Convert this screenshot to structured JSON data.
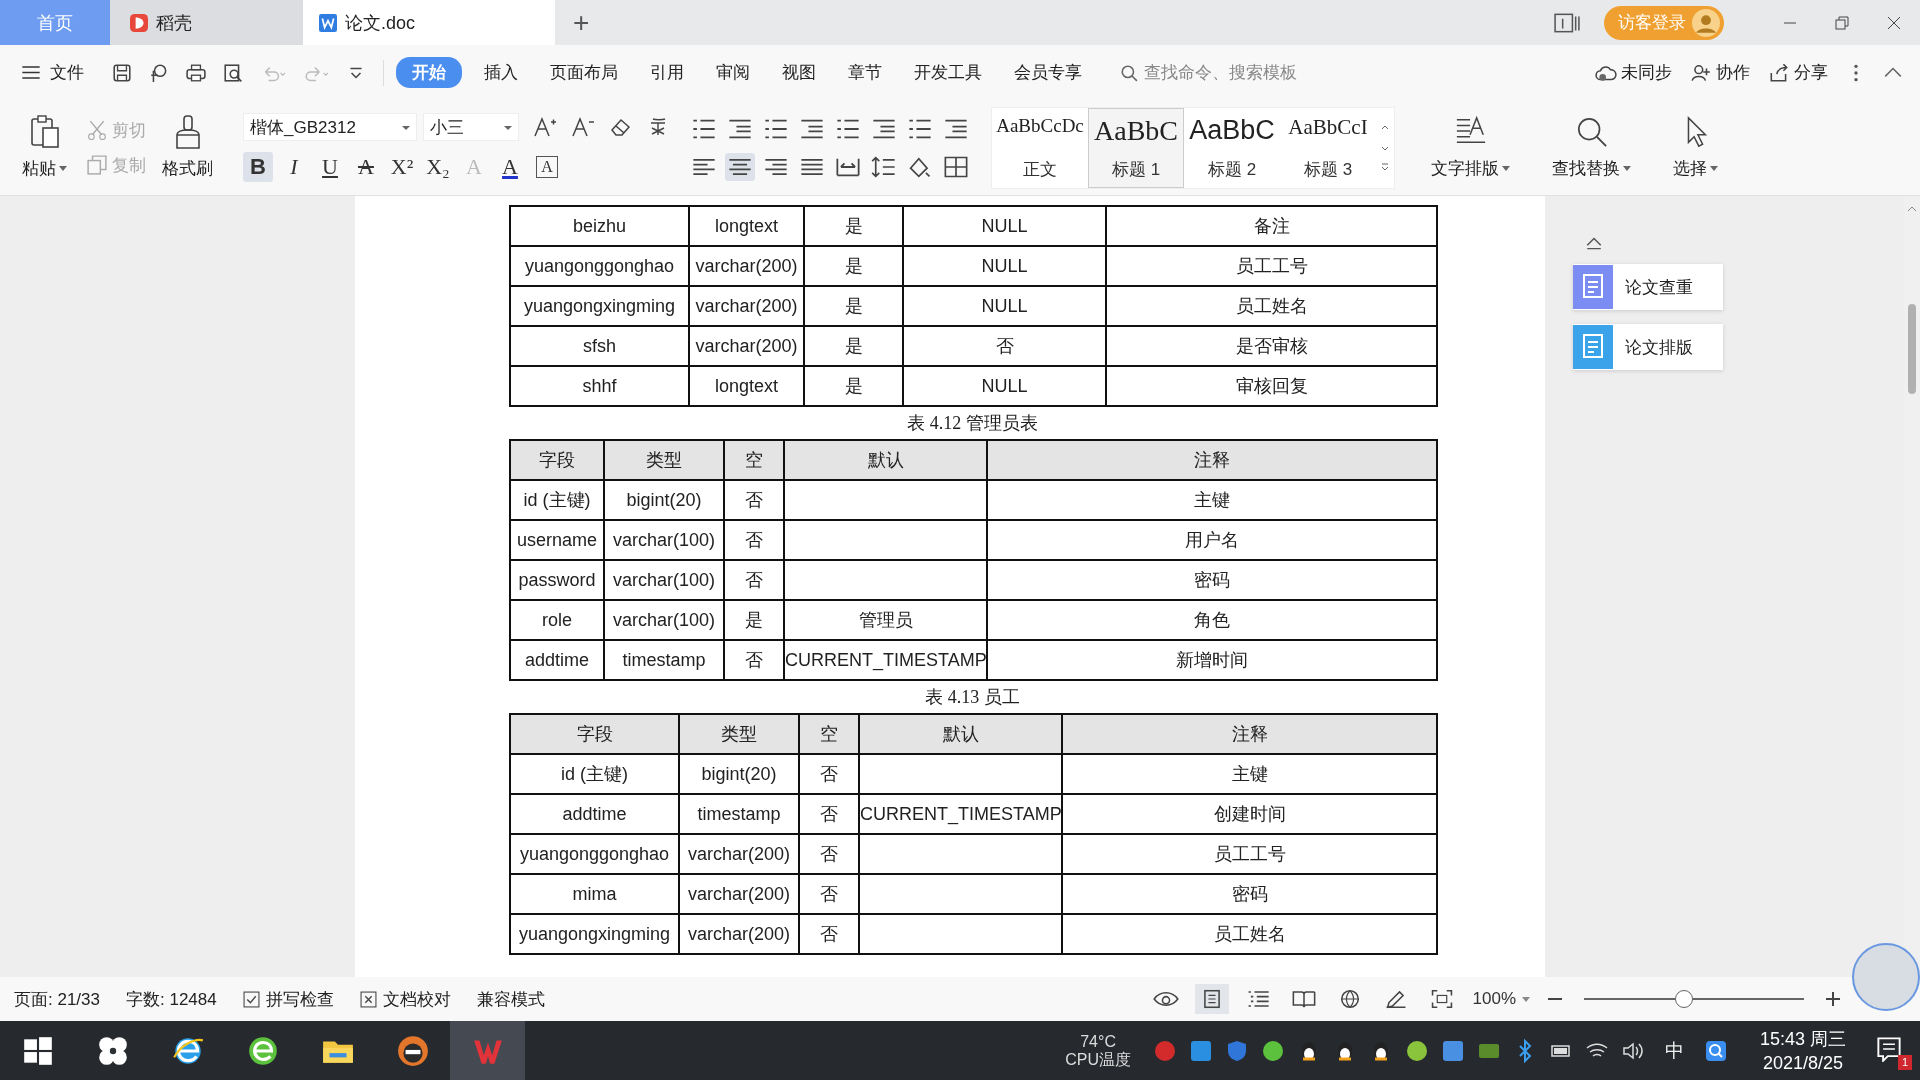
{
  "tabs": [
    {
      "label": "首页",
      "kind": "home",
      "selected": false
    },
    {
      "label": "稻壳",
      "kind": "docer",
      "selected": false
    },
    {
      "label": "论文.doc",
      "kind": "doc",
      "selected": true
    }
  ],
  "new_tab": "+",
  "login": "访客登录",
  "menu": {
    "file": "文件",
    "items": [
      {
        "label": "开始",
        "selected": true
      },
      {
        "label": "插入",
        "selected": false
      },
      {
        "label": "页面布局",
        "selected": false
      },
      {
        "label": "引用",
        "selected": false
      },
      {
        "label": "审阅",
        "selected": false
      },
      {
        "label": "视图",
        "selected": false
      },
      {
        "label": "章节",
        "selected": false
      },
      {
        "label": "开发工具",
        "selected": false
      },
      {
        "label": "会员专享",
        "selected": false
      }
    ],
    "search": {
      "placeholder": "查找命令、搜索模板"
    },
    "actions": [
      {
        "kind": "sync",
        "label": "未同步"
      },
      {
        "kind": "collab",
        "label": "协作"
      },
      {
        "kind": "share",
        "label": "分享"
      }
    ]
  },
  "toolbar": {
    "paste": "粘贴",
    "clipboard": [
      {
        "kind": "cut",
        "label": "剪切",
        "disabled": true
      },
      {
        "kind": "copy",
        "label": "复制",
        "disabled": true
      }
    ],
    "format_painter": "格式刷",
    "font": "楷体_GB2312",
    "size": "小三",
    "format_buttons": [
      {
        "glyph": "B",
        "kind": "bold",
        "selected": true
      },
      {
        "glyph": "I",
        "kind": "italic",
        "selected": false
      },
      {
        "glyph": "U",
        "kind": "underline",
        "selected": false
      },
      {
        "glyph": "A",
        "kind": "strike",
        "selected": false
      },
      {
        "glyph": "X²",
        "kind": "plain",
        "selected": false
      },
      {
        "glyph": "X₂",
        "kind": "plain",
        "selected": false
      },
      {
        "glyph": "A",
        "kind": "effect",
        "selected": false
      },
      {
        "glyph": "A",
        "kind": "color",
        "selected": false
      },
      {
        "glyph": "A",
        "kind": "boxed",
        "selected": false
      }
    ],
    "align_buttons": [
      {
        "kind": "left",
        "selected": false
      },
      {
        "kind": "center",
        "selected": true
      },
      {
        "kind": "right",
        "selected": false
      },
      {
        "kind": "justify",
        "selected": false
      },
      {
        "kind": "distribute",
        "selected": false
      }
    ],
    "styles": [
      {
        "sample": "AaBbCcDc",
        "name": "正文",
        "kind": "body",
        "selected": false
      },
      {
        "sample": "AaBbC",
        "name": "标题 1",
        "kind": "h1",
        "selected": true
      },
      {
        "sample": "AaBbC",
        "name": "标题 2",
        "kind": "h2",
        "selected": false
      },
      {
        "sample": "AaBbCcI",
        "name": "标题 3",
        "kind": "h3",
        "selected": false
      }
    ],
    "tools": [
      {
        "kind": "layout",
        "label": "文字排版"
      },
      {
        "kind": "find",
        "label": "查找替换"
      },
      {
        "kind": "select",
        "label": "选择"
      }
    ]
  },
  "document": {
    "tables": [
      {
        "rows": [
          [
            "beizhu",
            "longtext",
            "是",
            "NULL",
            "备注"
          ],
          [
            "yuangonggonghao",
            "varchar(200)",
            "是",
            "NULL",
            "员工工号"
          ],
          [
            "yuangongxingming",
            "varchar(200)",
            "是",
            "NULL",
            "员工姓名"
          ],
          [
            "sfsh",
            "varchar(200)",
            "是",
            "否",
            "是否审核"
          ],
          [
            "shhf",
            "longtext",
            "是",
            "NULL",
            "审核回复"
          ]
        ]
      },
      {
        "caption": "表 4.12  管理员表",
        "header": [
          "字段",
          "类型",
          "空",
          "默认",
          "注释"
        ],
        "rows": [
          [
            "id (主键)",
            "bigint(20)",
            "否",
            "",
            "主键"
          ],
          [
            "username",
            "varchar(100)",
            "否",
            "",
            "用户名"
          ],
          [
            "password",
            "varchar(100)",
            "否",
            "",
            "密码"
          ],
          [
            "role",
            "varchar(100)",
            "是",
            "管理员",
            "角色"
          ],
          [
            "addtime",
            "timestamp",
            "否",
            "CURRENT_TIMESTAMP",
            "新增时间"
          ]
        ]
      },
      {
        "caption": "表 4.13  员工",
        "header": [
          "字段",
          "类型",
          "空",
          "默认",
          "注释"
        ],
        "rows": [
          [
            "id (主键)",
            "bigint(20)",
            "否",
            "",
            "主键"
          ],
          [
            "addtime",
            "timestamp",
            "否",
            "CURRENT_TIMESTAMP",
            "创建时间"
          ],
          [
            "yuangonggonghao",
            "varchar(200)",
            "否",
            "",
            "员工工号"
          ],
          [
            "mima",
            "varchar(200)",
            "否",
            "",
            "密码"
          ],
          [
            "yuangongxingming",
            "varchar(200)",
            "否",
            "",
            "员工姓名"
          ]
        ]
      }
    ]
  },
  "side_panel": [
    {
      "kind": "check",
      "label": "论文查重"
    },
    {
      "kind": "format",
      "label": "论文排版"
    }
  ],
  "status_bar": {
    "page": "页面: 21/33",
    "words": "字数: 12484",
    "spell": "拼写检查",
    "proof": "文档校对",
    "mode": "兼容模式",
    "zoom": "100%",
    "zoom_slider": {
      "level": 0.45
    }
  },
  "taskbar": {
    "temp": "74°C",
    "temp_label": "CPU温度",
    "ime": "中",
    "time": "15:43 周三",
    "date": "2021/8/25",
    "notifications": "1"
  }
}
